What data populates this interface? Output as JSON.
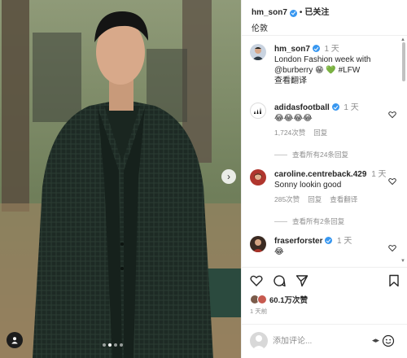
{
  "post": {
    "author": "hm_son7",
    "follow_status": "已关注",
    "location": "伦敦",
    "photo_count": 4,
    "active_photo": 2
  },
  "caption": {
    "username": "hm_son7",
    "time": "1 天",
    "line1": "London Fashion week with",
    "line2": "@burberry 😁 💚 #LFW",
    "translate": "查看翻译"
  },
  "comments": [
    {
      "username": "adidasfootball",
      "verified": true,
      "time": "1 天",
      "text": "😂😂😂😂",
      "likes": "1,724次赞",
      "reply": "回复",
      "translate": "",
      "view_replies": "查看所有24条回复"
    },
    {
      "username": "caroline.centreback.429",
      "verified": false,
      "time": "1 天",
      "text": "Sonny lookin good",
      "likes": "285次赞",
      "reply": "回复",
      "translate": "查看翻译",
      "view_replies": "查看所有2条回复"
    },
    {
      "username": "fraserforster",
      "verified": true,
      "time": "1 天",
      "text": "😂",
      "likes": "",
      "reply": "",
      "translate": "",
      "view_replies": ""
    }
  ],
  "actions": {
    "likes": "60.1万次赞",
    "time_ago": "1 天前"
  },
  "add_comment": {
    "placeholder": "添加评论..."
  },
  "colors": {
    "verified_blue": "#3897f0",
    "text_primary": "#262626",
    "text_secondary": "#8e8e8e"
  }
}
